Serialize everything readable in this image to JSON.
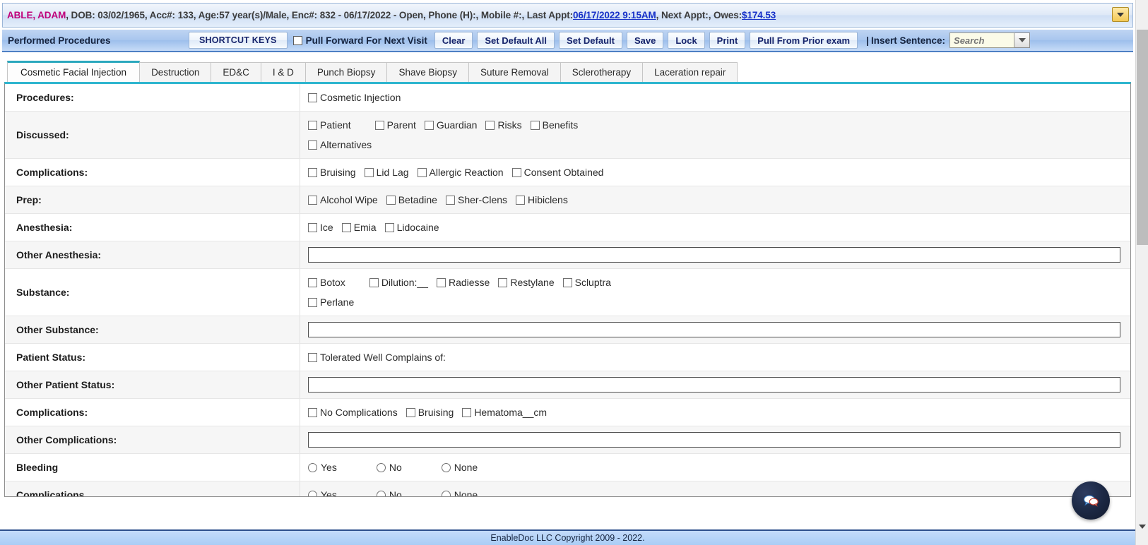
{
  "patient_header": {
    "name": "ABLE, ADAM",
    "details_1": ", DOB: 03/02/1965, Acc#: 133, Age:57 year(s)/Male, Enc#: 832 - 06/17/2022 - Open, Phone (H):, Mobile #:, Last Appt:",
    "last_appt": "06/17/2022 9:15AM",
    "details_2": ", Next Appt:, Owes:",
    "owes": "$174.53",
    "dropdown_icon": "chevron-down-icon"
  },
  "toolbar": {
    "title": "Performed Procedures",
    "shortcut_keys": "SHORTCUT KEYS",
    "pull_forward_label": "Pull Forward For Next Visit",
    "clear": "Clear",
    "set_default_all": "Set Default All",
    "set_default": "Set Default",
    "save": "Save",
    "lock": "Lock",
    "print": "Print",
    "pull_from_prior": "Pull From Prior exam",
    "separator": "|",
    "insert_sentence_label": "Insert Sentence:",
    "search_placeholder": "Search",
    "search_value": "",
    "search_dropdown_icon": "chevron-down-icon"
  },
  "tabs": [
    {
      "label": "Cosmetic Facial Injection",
      "active": true
    },
    {
      "label": "Destruction",
      "active": false
    },
    {
      "label": "ED&C",
      "active": false
    },
    {
      "label": "I & D",
      "active": false
    },
    {
      "label": "Punch Biopsy",
      "active": false
    },
    {
      "label": "Shave Biopsy",
      "active": false
    },
    {
      "label": "Suture Removal",
      "active": false
    },
    {
      "label": "Sclerotherapy",
      "active": false
    },
    {
      "label": "Laceration repair",
      "active": false
    }
  ],
  "form": {
    "rows": [
      {
        "label": "Procedures:",
        "type": "checkboxes",
        "lines": [
          [
            {
              "text": "Cosmetic Injection",
              "checked": false
            }
          ]
        ]
      },
      {
        "label": "Discussed:",
        "type": "checkboxes",
        "lines": [
          [
            {
              "text": "Patient",
              "checked": false,
              "wide": true
            },
            {
              "text": "Parent",
              "checked": false
            },
            {
              "text": "Guardian",
              "checked": false
            },
            {
              "text": "Risks",
              "checked": false
            },
            {
              "text": "Benefits",
              "checked": false
            }
          ],
          [
            {
              "text": "Alternatives",
              "checked": false
            }
          ]
        ]
      },
      {
        "label": "Complications:",
        "type": "checkboxes",
        "lines": [
          [
            {
              "text": "Bruising",
              "checked": false
            },
            {
              "text": "Lid Lag",
              "checked": false
            },
            {
              "text": "Allergic Reaction",
              "checked": false
            },
            {
              "text": "Consent Obtained",
              "checked": false
            }
          ]
        ]
      },
      {
        "label": "Prep:",
        "type": "checkboxes",
        "lines": [
          [
            {
              "text": "Alcohol Wipe",
              "checked": false
            },
            {
              "text": "Betadine",
              "checked": false
            },
            {
              "text": "Sher-Clens",
              "checked": false
            },
            {
              "text": "Hibiclens",
              "checked": false
            }
          ]
        ]
      },
      {
        "label": "Anesthesia:",
        "type": "checkboxes",
        "lines": [
          [
            {
              "text": "Ice",
              "checked": false
            },
            {
              "text": "Emia",
              "checked": false
            },
            {
              "text": "Lidocaine",
              "checked": false
            }
          ]
        ]
      },
      {
        "label": "Other Anesthesia:",
        "type": "text",
        "value": "",
        "placeholder": ""
      },
      {
        "label": "Substance:",
        "type": "checkboxes",
        "lines": [
          [
            {
              "text": "Botox",
              "checked": false,
              "wide": true
            },
            {
              "text": "Dilution:__",
              "checked": false
            },
            {
              "text": "Radiesse",
              "checked": false
            },
            {
              "text": "Restylane",
              "checked": false
            },
            {
              "text": "Scluptra",
              "checked": false
            }
          ],
          [
            {
              "text": "Perlane",
              "checked": false
            }
          ]
        ]
      },
      {
        "label": "Other Substance:",
        "type": "text",
        "value": "",
        "placeholder": ""
      },
      {
        "label": "Patient Status:",
        "type": "checkboxes",
        "lines": [
          [
            {
              "text": "Tolerated Well Complains of:",
              "checked": false
            }
          ]
        ]
      },
      {
        "label": "Other Patient Status:",
        "type": "text",
        "value": "",
        "placeholder": ""
      },
      {
        "label": "Complications:",
        "type": "checkboxes",
        "lines": [
          [
            {
              "text": "No Complications",
              "checked": false
            },
            {
              "text": "Bruising",
              "checked": false
            },
            {
              "text": "Hematoma__cm",
              "checked": false
            }
          ]
        ]
      },
      {
        "label": "Other Complications:",
        "type": "text",
        "value": "",
        "placeholder": ""
      },
      {
        "label": "Bleeding",
        "type": "radios",
        "lines": [
          [
            {
              "text": "Yes",
              "checked": false
            },
            {
              "text": "No",
              "checked": false
            },
            {
              "text": "None",
              "checked": false
            }
          ]
        ]
      },
      {
        "label": "Complications",
        "type": "radios",
        "lines": [
          [
            {
              "text": "Yes",
              "checked": false
            },
            {
              "text": "No",
              "checked": false
            },
            {
              "text": "None",
              "checked": false
            }
          ]
        ]
      }
    ]
  },
  "chat": {
    "icon": "chat-bubble-icon"
  },
  "footer": {
    "text": "EnableDoc LLC Copyright 2009 - 2022."
  },
  "scrollbar": {
    "down_arrow_icon": "triangle-down-icon"
  },
  "colors": {
    "accent_teal": "#2fb6cf",
    "patient_name": "#c0007a",
    "link": "#1630c8",
    "toolbar_blue": "#a8c6ee",
    "button_text": "#16246b"
  }
}
